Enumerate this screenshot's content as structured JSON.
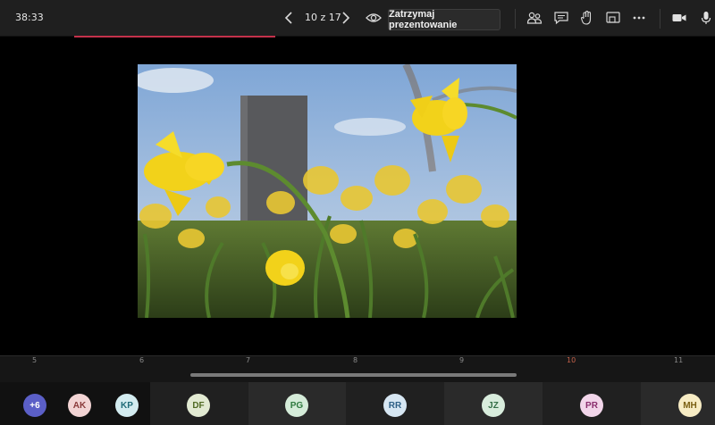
{
  "toolbar": {
    "timer": "38:33",
    "slide_counter": "10 z 17",
    "stop_presenting_label": "Zatrzymaj prezentowanie",
    "accent_color": "#c4314b"
  },
  "icons": {
    "prev": "chevron-left-icon",
    "next": "chevron-right-icon",
    "eye": "eye-icon",
    "participants": "people-icon",
    "chat": "chat-icon",
    "reactions": "raise-hand-icon",
    "share": "share-tray-icon",
    "more": "more-options-icon",
    "camera": "camera-icon",
    "mic": "microphone-icon"
  },
  "timeline": {
    "ticks": [
      "5",
      "6",
      "7",
      "8",
      "9",
      "10",
      "11"
    ],
    "active_tick": "10"
  },
  "participants": {
    "overflow_label": "+6",
    "people": [
      {
        "initials": "AK",
        "bg": "#f2d4d4",
        "fg": "#8a3a3a"
      },
      {
        "initials": "KP",
        "bg": "#d3ecf0",
        "fg": "#1f6b78"
      },
      {
        "initials": "DF",
        "bg": "#e2ead2",
        "fg": "#4f6a22"
      },
      {
        "initials": "PG",
        "bg": "#d5ecd9",
        "fg": "#2f7a3f"
      },
      {
        "initials": "RR",
        "bg": "#d6e6f2",
        "fg": "#2d5f86"
      },
      {
        "initials": "JZ",
        "bg": "#d8ecdc",
        "fg": "#356f47"
      },
      {
        "initials": "PR",
        "bg": "#f2d6ea",
        "fg": "#8a2f6e"
      },
      {
        "initials": "MH",
        "bg": "#f7ecc4",
        "fg": "#7a5f12"
      }
    ]
  }
}
